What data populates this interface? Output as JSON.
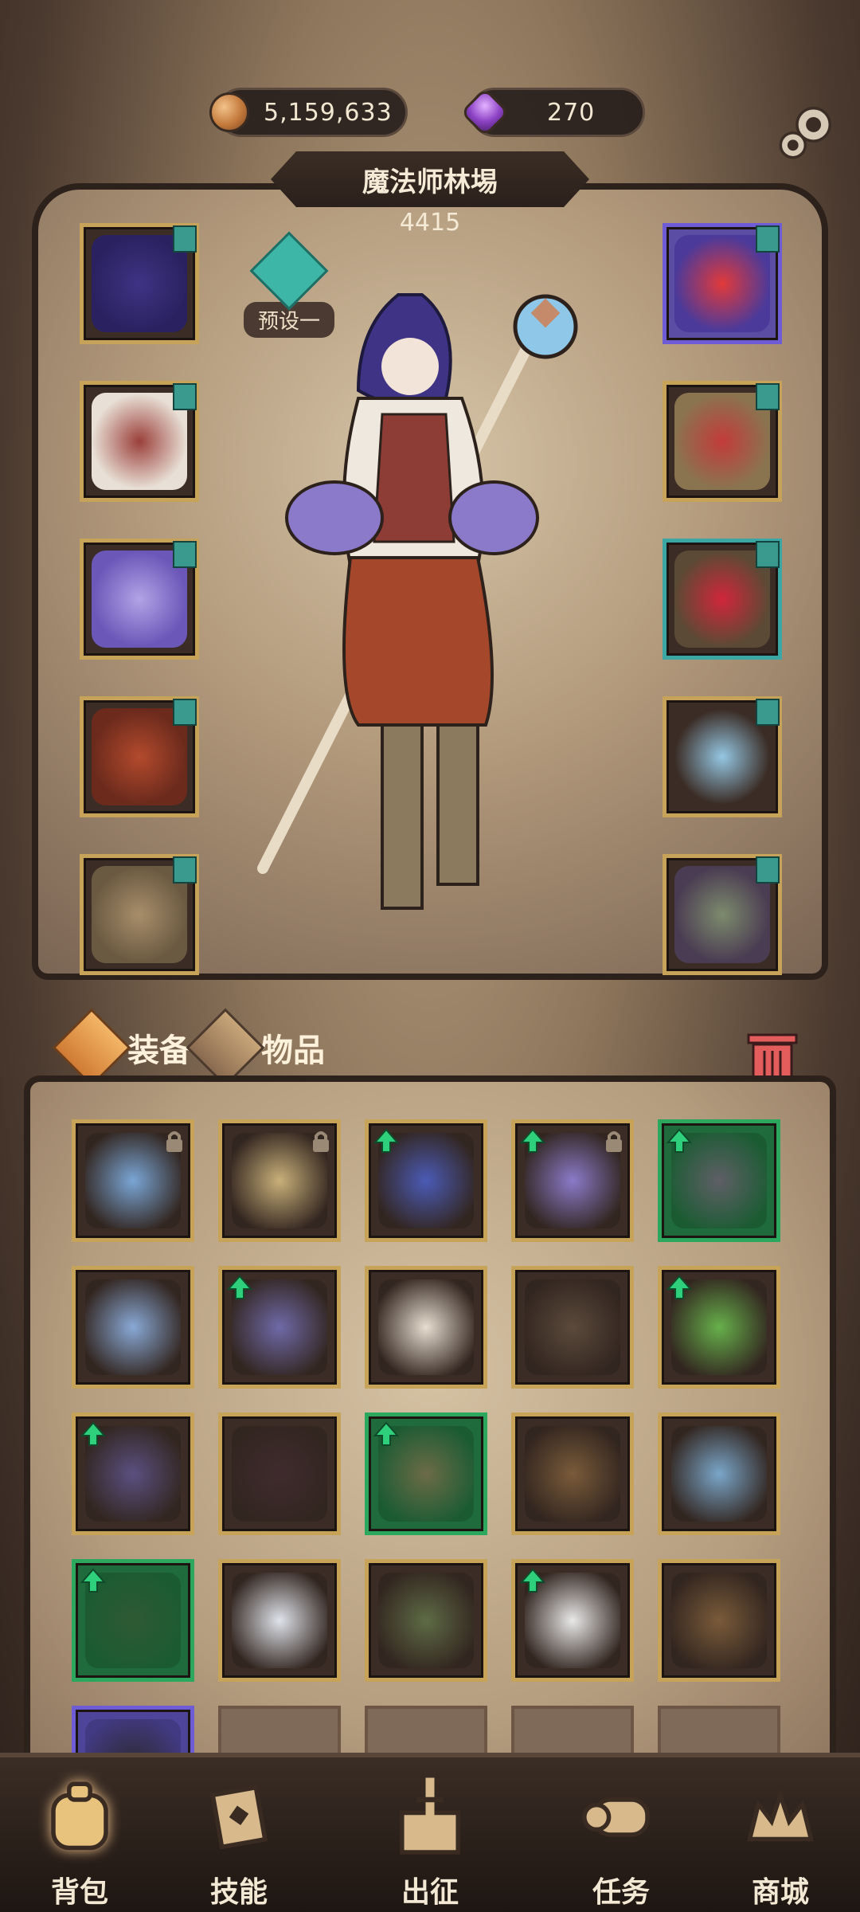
{
  "resources": {
    "coins": "5,159,633",
    "gems": "270"
  },
  "character": {
    "name": "魔法师林埸",
    "power": "4415",
    "preset_label": "预设一"
  },
  "tabs": [
    {
      "label": "装备",
      "active": true
    },
    {
      "label": "物品",
      "active": false
    }
  ],
  "left_equipment": [
    {
      "name": "hood",
      "rarity": "gold"
    },
    {
      "name": "vest",
      "rarity": "gold"
    },
    {
      "name": "gloves",
      "rarity": "gold"
    },
    {
      "name": "skirt",
      "rarity": "gold"
    },
    {
      "name": "boots",
      "rarity": "gold"
    }
  ],
  "right_equipment": [
    {
      "name": "necklace",
      "rarity": "purple"
    },
    {
      "name": "ring",
      "rarity": "gold"
    },
    {
      "name": "ring",
      "rarity": "teal"
    },
    {
      "name": "staff",
      "rarity": "gold"
    },
    {
      "name": "cloak",
      "rarity": "gold"
    }
  ],
  "inventory": [
    {
      "rarity": "gold",
      "up": false,
      "locked": true
    },
    {
      "rarity": "gold",
      "up": false,
      "locked": true
    },
    {
      "rarity": "gold",
      "up": true,
      "locked": false
    },
    {
      "rarity": "gold",
      "up": true,
      "locked": true
    },
    {
      "rarity": "green",
      "up": true,
      "locked": false
    },
    {
      "rarity": "gold",
      "up": false,
      "locked": false
    },
    {
      "rarity": "gold",
      "up": true,
      "locked": false
    },
    {
      "rarity": "gold",
      "up": false,
      "locked": false
    },
    {
      "rarity": "gold",
      "up": false,
      "locked": false
    },
    {
      "rarity": "gold",
      "up": true,
      "locked": false
    },
    {
      "rarity": "gold",
      "up": true,
      "locked": false
    },
    {
      "rarity": "gold",
      "up": false,
      "locked": false
    },
    {
      "rarity": "green",
      "up": true,
      "locked": false
    },
    {
      "rarity": "gold",
      "up": false,
      "locked": false
    },
    {
      "rarity": "gold",
      "up": false,
      "locked": false
    },
    {
      "rarity": "green",
      "up": true,
      "locked": false
    },
    {
      "rarity": "gold",
      "up": false,
      "locked": false
    },
    {
      "rarity": "gold",
      "up": false,
      "locked": false
    },
    {
      "rarity": "gold",
      "up": true,
      "locked": false
    },
    {
      "rarity": "gold",
      "up": false,
      "locked": false
    },
    {
      "rarity": "purple",
      "up": false,
      "locked": false
    },
    {
      "rarity": "empty"
    },
    {
      "rarity": "empty"
    },
    {
      "rarity": "empty"
    },
    {
      "rarity": "empty"
    }
  ],
  "nav": [
    {
      "label": "背包",
      "icon": "backpack-icon",
      "active": true
    },
    {
      "label": "技能",
      "icon": "skill-book-icon",
      "active": false
    },
    {
      "label": "出征",
      "icon": "battle-sword-icon",
      "active": false
    },
    {
      "label": "任务",
      "icon": "quest-scroll-icon",
      "active": false
    },
    {
      "label": "商城",
      "icon": "shop-crown-icon",
      "active": false
    }
  ],
  "colors": {
    "gold_border": "#c7a35a",
    "green_border": "#2ba75e",
    "purple_border": "#6e5bd6",
    "teal_border": "#3aa7a5"
  }
}
